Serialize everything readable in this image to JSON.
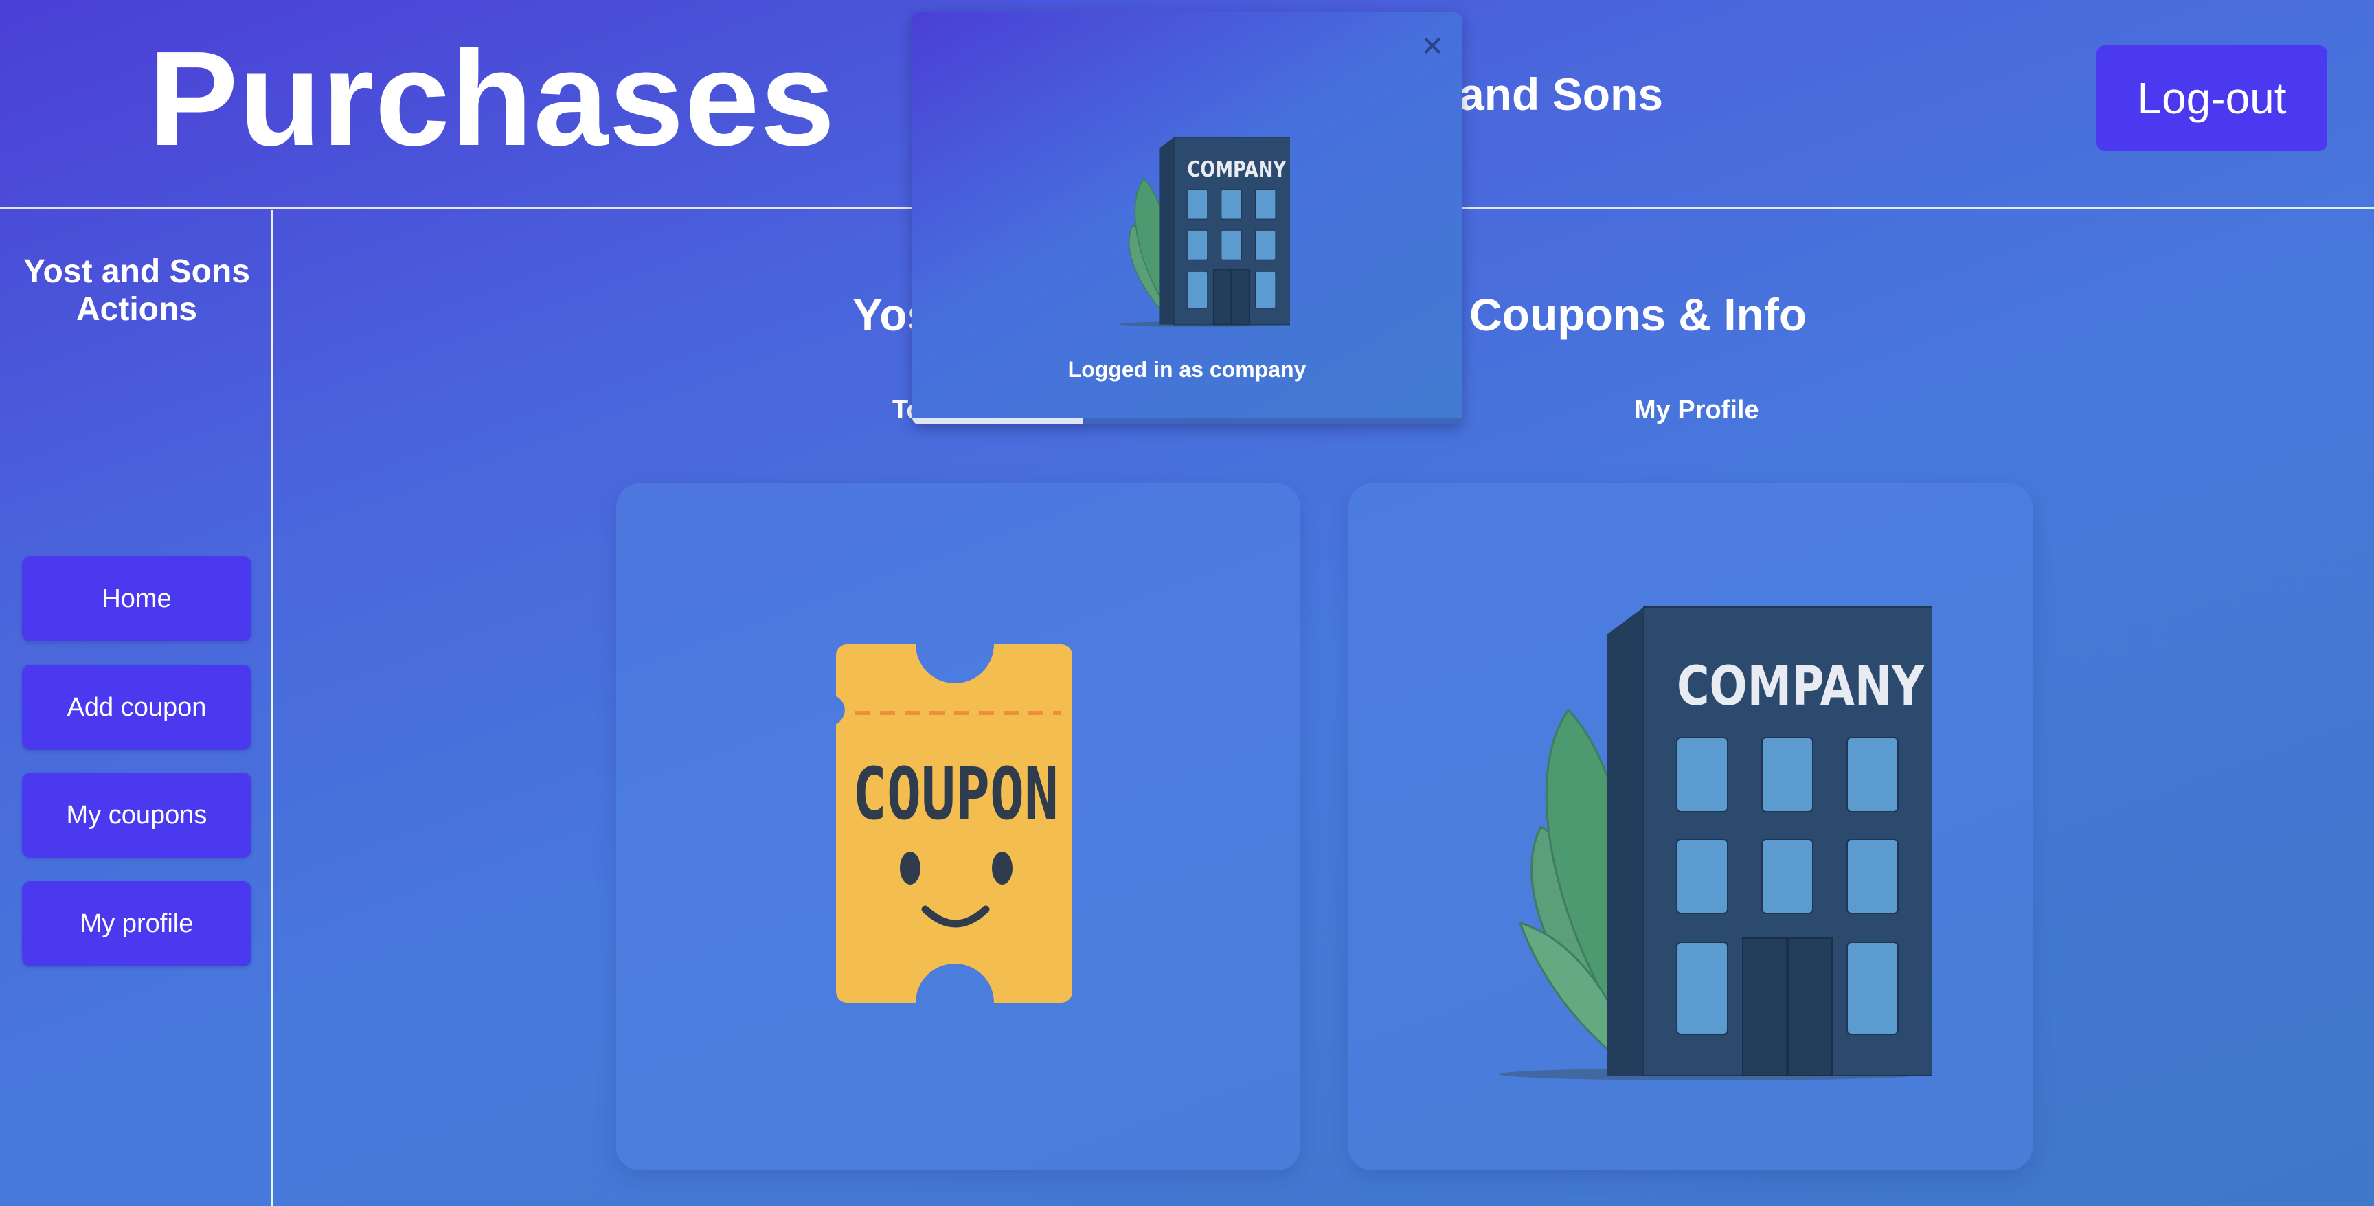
{
  "header": {
    "title": "Purchases",
    "company_name": "and Sons",
    "logout_label": "Log-out"
  },
  "sidebar": {
    "title": "Yost and Sons\nActions",
    "items": [
      {
        "label": "Home"
      },
      {
        "label": "Add coupon"
      },
      {
        "label": "My coupons"
      },
      {
        "label": "My profile"
      }
    ]
  },
  "main": {
    "section_title_left": "Yos",
    "section_title_right": "Coupons & Info",
    "cards": [
      {
        "label": "To",
        "icon": "coupon-ticket-icon",
        "icon_text": "COUPON"
      },
      {
        "label": "My Profile",
        "icon": "company-building-icon",
        "icon_text": "COMPANY"
      }
    ]
  },
  "toast": {
    "message": "Logged in as company",
    "icon": "company-building-icon",
    "icon_text": "COMPANY",
    "close_icon": "close-icon",
    "progress": 0.31
  },
  "colors": {
    "accent_button": "#4a39ef",
    "coupon_yellow": "#f4bd4f",
    "building_navy": "#2c4a6e",
    "window_blue": "#5b9bd0",
    "leaf_green": "#4e9a70"
  }
}
